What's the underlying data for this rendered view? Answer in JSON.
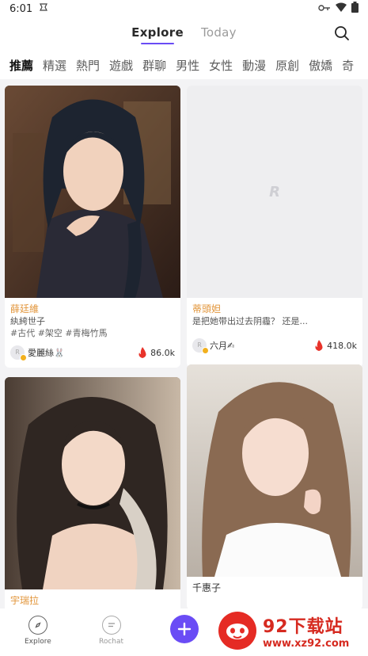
{
  "status_bar": {
    "time": "6:01"
  },
  "header": {
    "tabs": [
      {
        "label": "Explore"
      },
      {
        "label": "Today"
      }
    ]
  },
  "categories": [
    "推薦",
    "精選",
    "熱門",
    "遊戲",
    "群聊",
    "男性",
    "女性",
    "動漫",
    "原創",
    "傲嬌",
    "奇"
  ],
  "cards": [
    {
      "name": "薛廷維",
      "desc": "紈絝世子",
      "tags": "#古代 #架空 #青梅竹馬",
      "author": "愛麗絲🐰",
      "likes": "86.0k"
    },
    {
      "name": "蒂頭妲",
      "desc": "是把她带出过去阴霾？ 还是...",
      "tags": "",
      "author": "六月✍",
      "likes": "418.0k",
      "placeholder_logo": "R"
    },
    {
      "name": "宇瑞拉",
      "desc": "",
      "tags": "",
      "author": "",
      "likes": ""
    },
    {
      "name": "千惠子",
      "desc": "",
      "tags": "",
      "author": "",
      "likes": ""
    }
  ],
  "nav": {
    "explore_label": "Explore",
    "rochat_label": "Rochat"
  },
  "watermark": {
    "title": "92下载站",
    "url": "www.xz92.com"
  },
  "colors": {
    "accent": "#6a4cf5",
    "name_orange": "#e2953a",
    "fire": "#e8332a",
    "watermark_red": "#d62a20"
  }
}
